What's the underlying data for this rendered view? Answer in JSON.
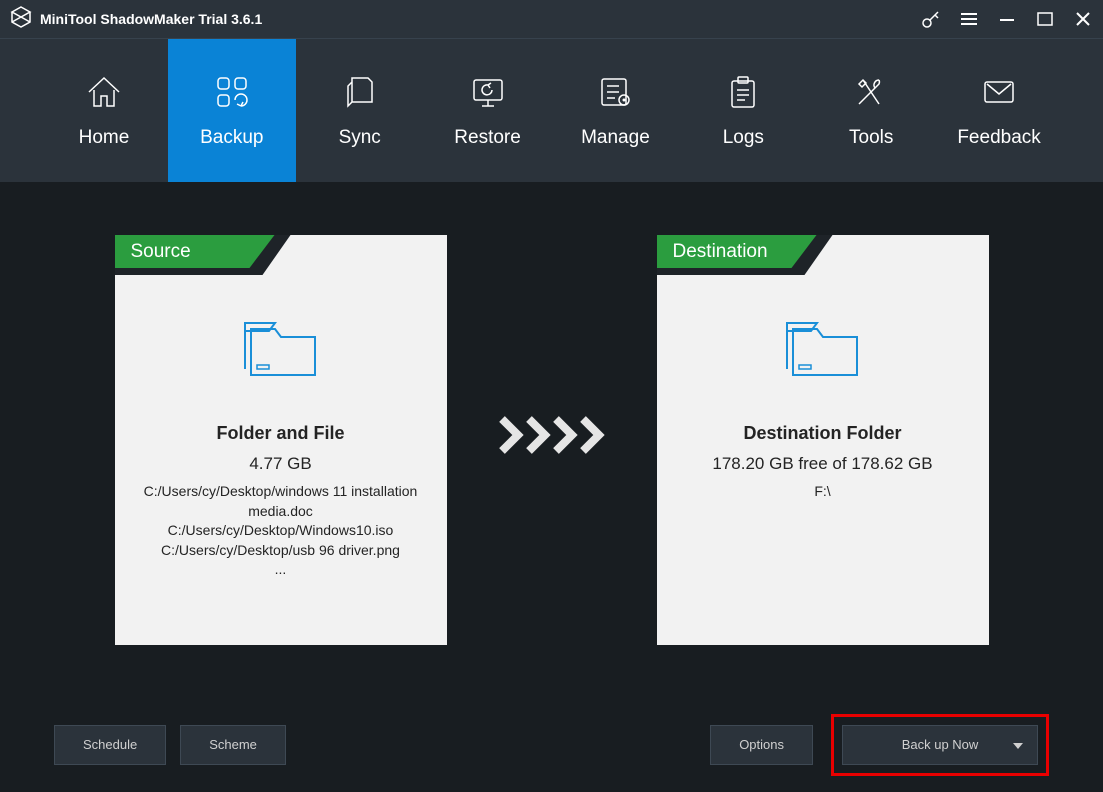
{
  "titlebar": {
    "title": "MiniTool ShadowMaker Trial 3.6.1"
  },
  "nav": {
    "items": [
      {
        "label": "Home"
      },
      {
        "label": "Backup"
      },
      {
        "label": "Sync"
      },
      {
        "label": "Restore"
      },
      {
        "label": "Manage"
      },
      {
        "label": "Logs"
      },
      {
        "label": "Tools"
      },
      {
        "label": "Feedback"
      }
    ]
  },
  "source": {
    "tab": "Source",
    "title": "Folder and File",
    "size": "4.77 GB",
    "path1": "C:/Users/cy/Desktop/windows 11 installation media.doc",
    "path2": "C:/Users/cy/Desktop/Windows10.iso",
    "path3": "C:/Users/cy/Desktop/usb 96 driver.png",
    "more": "..."
  },
  "destination": {
    "tab": "Destination",
    "title": "Destination Folder",
    "size": "178.20 GB free of 178.62 GB",
    "path": "F:\\"
  },
  "footer": {
    "schedule": "Schedule",
    "scheme": "Scheme",
    "options": "Options",
    "backup_now": "Back up Now"
  }
}
